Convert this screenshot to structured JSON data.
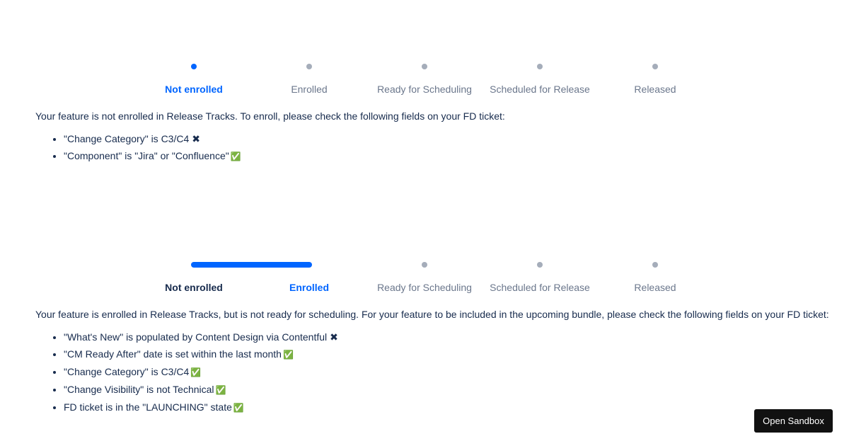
{
  "steps": [
    "Not enrolled",
    "Enrolled",
    "Ready for Scheduling",
    "Scheduled for Release",
    "Released"
  ],
  "section1": {
    "description": "Your feature is not enrolled in Release Tracks. To enroll, please check the following fields on your FD ticket:",
    "checks": [
      {
        "text": "\"Change Category\" is C3/C4",
        "status": "fail",
        "mark": "✖"
      },
      {
        "text": "\"Component\" is \"Jira\" or \"Confluence\"",
        "status": "pass",
        "mark": "✅"
      }
    ]
  },
  "section2": {
    "description": "Your feature is enrolled in Release Tracks, but is not ready for scheduling. For your feature to be included in the upcoming bundle, please check the following fields on your FD ticket:",
    "checks": [
      {
        "text": "\"What's New\" is populated by Content Design via Contentful",
        "status": "fail",
        "mark": "✖"
      },
      {
        "text": "\"CM Ready After\" date is set within the last month",
        "status": "pass",
        "mark": "✅"
      },
      {
        "text": "\"Change Category\" is C3/C4",
        "status": "pass",
        "mark": "✅"
      },
      {
        "text": "\"Change Visibility\" is not Technical",
        "status": "pass",
        "mark": "✅"
      },
      {
        "text": "FD ticket is in the \"LAUNCHING\" state",
        "status": "pass",
        "mark": "✅"
      }
    ]
  },
  "sandbox_button": "Open Sandbox",
  "colors": {
    "accent": "#0065ff",
    "inactive_dot": "#a5adba",
    "inactive_text": "#6b778c",
    "text": "#172b4d",
    "button_bg": "#111111"
  }
}
